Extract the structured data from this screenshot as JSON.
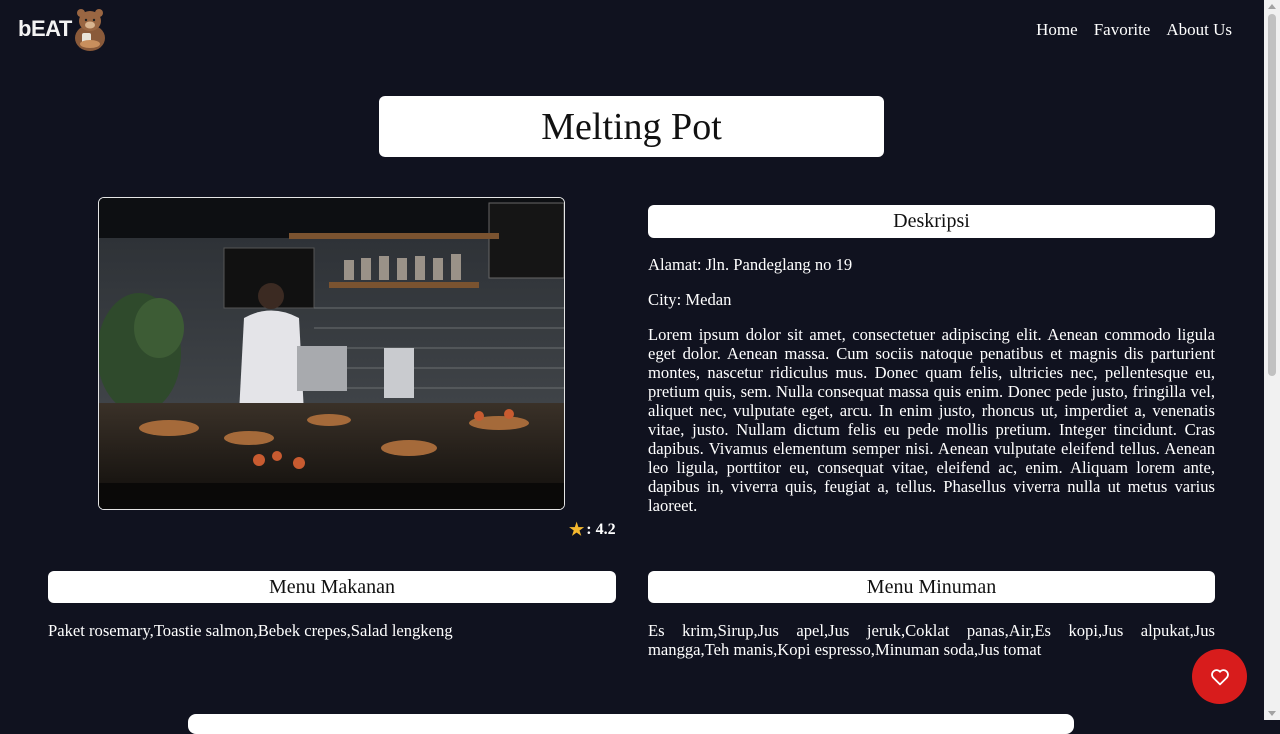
{
  "nav": {
    "logo_text": "bEAT",
    "links": [
      "Home",
      "Favorite",
      "About Us"
    ]
  },
  "restaurant": {
    "name": "Melting Pot",
    "rating_label": ": 4.2"
  },
  "description": {
    "heading": "Deskripsi",
    "address": "Alamat: Jln. Pandeglang no 19",
    "city": "City: Medan",
    "text": "Lorem ipsum dolor sit amet, consectetuer adipiscing elit. Aenean commodo ligula eget dolor. Aenean massa. Cum sociis natoque penatibus et magnis dis parturient montes, nascetur ridiculus mus. Donec quam felis, ultricies nec, pellentesque eu, pretium quis, sem. Nulla consequat massa quis enim. Donec pede justo, fringilla vel, aliquet nec, vulputate eget, arcu. In enim justo, rhoncus ut, imperdiet a, venenatis vitae, justo. Nullam dictum felis eu pede mollis pretium. Integer tincidunt. Cras dapibus. Vivamus elementum semper nisi. Aenean vulputate eleifend tellus. Aenean leo ligula, porttitor eu, consequat vitae, eleifend ac, enim. Aliquam lorem ante, dapibus in, viverra quis, feugiat a, tellus. Phasellus viverra nulla ut metus varius laoreet."
  },
  "menu_food": {
    "heading": "Menu Makanan",
    "items": "Paket rosemary,Toastie salmon,Bebek crepes,Salad lengkeng"
  },
  "menu_drink": {
    "heading": "Menu Minuman",
    "items": "Es krim,Sirup,Jus apel,Jus jeruk,Coklat panas,Air,Es kopi,Jus alpukat,Jus mangga,Teh manis,Kopi espresso,Minuman soda,Jus tomat"
  },
  "colors": {
    "background": "#10121f",
    "favorite_button": "#d81c1c",
    "star": "#f5b82e"
  },
  "icons": {
    "logo": "bear-logo-icon",
    "rating": "star-icon",
    "favorite": "heart-icon"
  }
}
